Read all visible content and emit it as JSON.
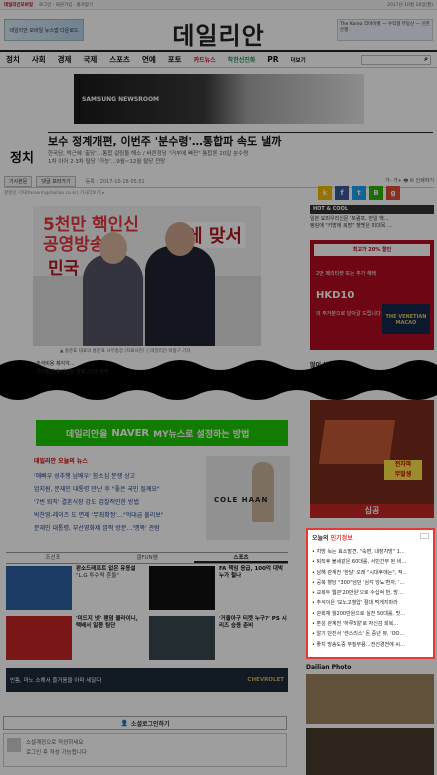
{
  "topbar": {
    "brand": "데일리안모바일",
    "links": "로그인 · 회원가입 · 즐겨찾기",
    "date": "2017년 10월 16일(월)"
  },
  "header": {
    "logo": "데일리안",
    "left_ad": "데일리안 모바일 뉴스앱 다운로드",
    "right_ad": "The Korea 리바이벌 — 수익형 부동산 — 신한은행"
  },
  "nav": {
    "items": [
      "정치",
      "사회",
      "경제",
      "국제",
      "스포츠",
      "연예",
      "포토"
    ],
    "accent": "카드뉴스",
    "green": "착한선진화",
    "extra": "PR",
    "more": "더보기",
    "search_icon": "⌕"
  },
  "top_ad": {
    "text": "SAMSUNG NEWSROOM"
  },
  "article": {
    "category": "정치",
    "headline": "보수 정계개편, 이번주 '분수령'…통합파 속도 낼까",
    "subhead": "한국당, 박근혜 '출당'…통합 걸림돌 해소 / 바른정당 \"거부에 빠진\" 통합론 20일 분수령\n1차 이어 2·3차 탈당 '가능'…9월~12월 탈당 전망",
    "tab": "기사본문",
    "comment_tab": "댓글 보러가기",
    "date": "등록 : 2017-10-16 05:51",
    "tools": "가-  가+  🖶  ✉  인쇄하기",
    "byline": "황정민 기자(forsenh@dailian.co.kr)  기사더보기 ▸",
    "photo": {
      "t1": "5천만 핵인신",
      "t2": "공영방송",
      "t3": "에 맞서",
      "t4": "민국"
    },
    "caption": "▲ 홍준표 대표와 홍문표 사무총장 (자료사진) ⓒ데일리안 박항구 기자",
    "bullets": [
      "추석비용 제각각…",
      "군인할인 후려치는 관행 20대 한정"
    ]
  },
  "share": [
    {
      "label": "k",
      "color": "#f3b800"
    },
    {
      "label": "f",
      "color": "#3b5998"
    },
    {
      "label": "t",
      "color": "#1da1f2"
    },
    {
      "label": "B",
      "color": "#2db400"
    },
    {
      "label": "g",
      "color": "#dd4b39"
    }
  ],
  "naver": {
    "text": "데일리안을",
    "naver": "NAVER",
    "rest": "MY뉴스로 설정하는 방법"
  },
  "related": {
    "title": "데일리안 오늘의 뉴스",
    "items": [
      "'애빠우 성추행 남배우' 함소심 분쟁 상고",
      "엄지원, 문재인 대통령 만난 후 \"좋은 국민 될께요\"",
      "'7번 퇴직' 결혼식장 강도 검찰적인한 방법",
      "박찬영-레이즈 도 면제 '무죄확정'…\"억대급 불리보\"",
      "문재인 대통령, 부산영화제 깜짝 방문…'맹목' 관람"
    ]
  },
  "coleh": {
    "brand": "COLE HAAN"
  },
  "tabs": {
    "items": [
      "조선포",
      "갤FUN쌤",
      "스포츠"
    ],
    "active": 2
  },
  "news": [
    {
      "title": "판소드래프트 없은 유용설",
      "body": "\"L.G 투수력 흔들\"",
      "color": "#2e5fa3"
    },
    {
      "title": "FA 책임 응급, 100억 대박 누가 될나",
      "body": "",
      "color": "#111"
    },
    {
      "title": "'미드지 넷' 팬덤 블라이니, 택배서 일몽 팀단",
      "body": "",
      "color": "#c62828"
    },
    {
      "title": "'거울아구 티켓 누구?' PS 시리즈 승용 준비",
      "body": "",
      "color": "#37474f"
    }
  ],
  "bottom_ad": {
    "text": "빈틈, 마노 소해서 즐거움을 아파 세달다",
    "brand": "CHEVROLET"
  },
  "social": {
    "text": "소셜로그인하기"
  },
  "comment": {
    "line1": "소셜계정으로 작성하세요",
    "line2": "로그인 후 작성 가능합니다"
  },
  "right": {
    "hot": "HOT & COOL",
    "hot_items": [
      "일본 요미우리신문 '트럼프, 한일 핵…",
      "랭킹에 \"키방에 북방\" 헬멧은 피대목 …"
    ],
    "hk": {
      "tag": "최고가 20% 할인",
      "a": "2번 페리티켓 또는 추가 혜택",
      "b": "HKD10",
      "c": "의 주거분으로 달아갈 드립니다",
      "v": "THE VENETIAN MACAO"
    },
    "many": "많이 본 기사",
    "rbox": "십공"
  },
  "popular": {
    "title": "오늘의",
    "title2": "인기정보",
    "items": [
      "지방 녹는 효소발견, \"숙변, 내장지방\" 1…",
      "퇴직후 불세같은 60대롤, 서민간부 된 비…",
      "남해 관계전 '한달' 오래 \"시대후에는\", 적…",
      "공복 혈당 \"300\"넘던 '심각 당뇨'환자, '…",
      "교복두 웹관'20만원'으로 수십억 번, 방…",
      "추석이은 '모노고혈압' 절대 먹게지마라",
      "관회재 월200만원으로 실전 50대롤, 맛…",
      "혼성 관계전 '하루5알'로 자신감 회복…",
      "알기 단진서 '센스리스' 돈 중년 뷰, 'OO…",
      "좋지 방송도중 무질부용…전선경전에 씨…"
    ]
  },
  "dailian_photo": "Dailian Photo"
}
